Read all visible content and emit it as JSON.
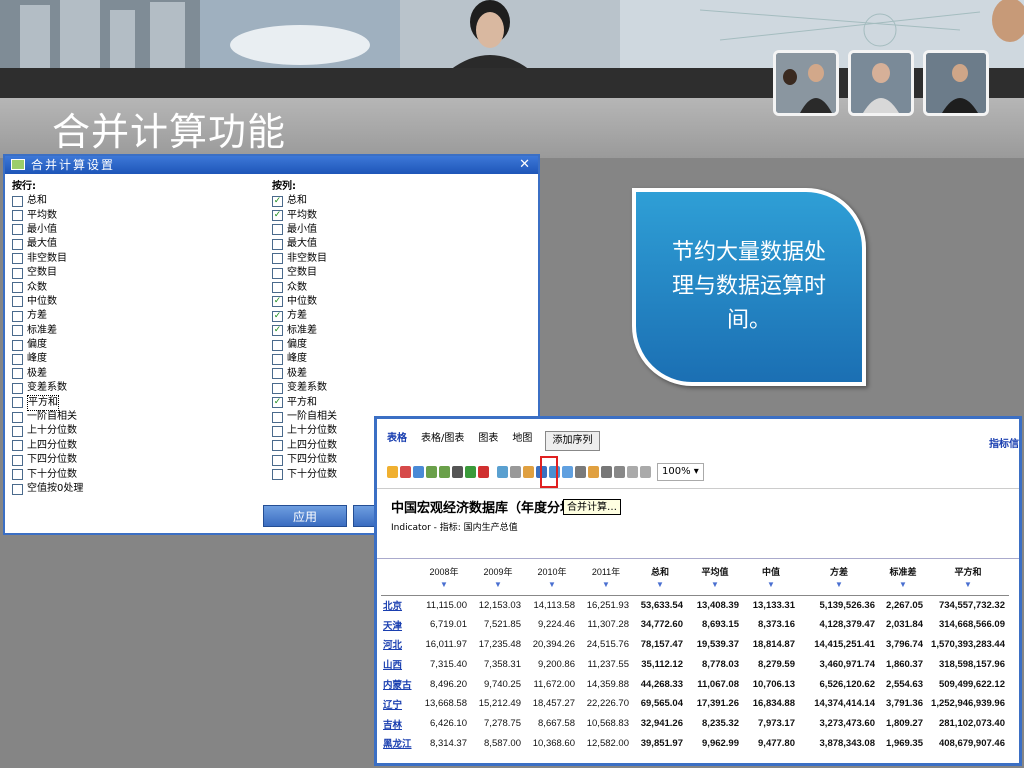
{
  "title": "合并计算功能",
  "dialog": {
    "title": "合并计算设置",
    "close": "✕",
    "row_header": "按行:",
    "col_header": "按列:",
    "row_options": [
      {
        "label": "总和",
        "checked": false
      },
      {
        "label": "平均数",
        "checked": false
      },
      {
        "label": "最小值",
        "checked": false
      },
      {
        "label": "最大值",
        "checked": false
      },
      {
        "label": "非空数目",
        "checked": false
      },
      {
        "label": "空数目",
        "checked": false
      },
      {
        "label": "众数",
        "checked": false
      },
      {
        "label": "中位数",
        "checked": false
      },
      {
        "label": "方差",
        "checked": false
      },
      {
        "label": "标准差",
        "checked": false
      },
      {
        "label": "偏度",
        "checked": false
      },
      {
        "label": "峰度",
        "checked": false
      },
      {
        "label": "极差",
        "checked": false
      },
      {
        "label": "变差系数",
        "checked": false
      },
      {
        "label": "平方和",
        "checked": false
      },
      {
        "label": "一阶自相关",
        "checked": false
      },
      {
        "label": "上十分位数",
        "checked": false
      },
      {
        "label": "上四分位数",
        "checked": false
      },
      {
        "label": "下四分位数",
        "checked": false
      },
      {
        "label": "下十分位数",
        "checked": false
      },
      {
        "label": "空值按0处理",
        "checked": false
      }
    ],
    "col_options": [
      {
        "label": "总和",
        "checked": true
      },
      {
        "label": "平均数",
        "checked": true
      },
      {
        "label": "最小值",
        "checked": false
      },
      {
        "label": "最大值",
        "checked": false
      },
      {
        "label": "非空数目",
        "checked": false
      },
      {
        "label": "空数目",
        "checked": false
      },
      {
        "label": "众数",
        "checked": false
      },
      {
        "label": "中位数",
        "checked": true
      },
      {
        "label": "方差",
        "checked": true
      },
      {
        "label": "标准差",
        "checked": true
      },
      {
        "label": "偏度",
        "checked": false
      },
      {
        "label": "峰度",
        "checked": false
      },
      {
        "label": "极差",
        "checked": false
      },
      {
        "label": "变差系数",
        "checked": false
      },
      {
        "label": "平方和",
        "checked": true
      },
      {
        "label": "一阶自相关",
        "checked": false
      },
      {
        "label": "上十分位数",
        "checked": false
      },
      {
        "label": "上四分位数",
        "checked": false
      },
      {
        "label": "下四分位数",
        "checked": false
      },
      {
        "label": "下十分位数",
        "checked": false
      }
    ],
    "apply_label": "应用"
  },
  "callout": {
    "text": "节约大量数据处理与数据运算时间。"
  },
  "window": {
    "tabs": [
      "表格",
      "表格/图表",
      "图表",
      "地图"
    ],
    "add_series": "添加序列",
    "right_link": "指标信",
    "zoom": "100%",
    "db_title": "中国宏观经济数据库（年度分地区",
    "tooltip": "合并计算…",
    "indicator": "Indicator - 指标: 国内生产总值",
    "columns": [
      "2008年",
      "2009年",
      "2010年",
      "2011年",
      "总和",
      "平均值",
      "中值",
      "方差",
      "标准差",
      "平方和"
    ],
    "rows": [
      [
        "北京",
        "11,115.00",
        "12,153.03",
        "14,113.58",
        "16,251.93",
        "53,633.54",
        "13,408.39",
        "13,133.31",
        "5,139,526.36",
        "2,267.05",
        "734,557,732.32"
      ],
      [
        "天津",
        "6,719.01",
        "7,521.85",
        "9,224.46",
        "11,307.28",
        "34,772.60",
        "8,693.15",
        "8,373.16",
        "4,128,379.47",
        "2,031.84",
        "314,668,566.09"
      ],
      [
        "河北",
        "16,011.97",
        "17,235.48",
        "20,394.26",
        "24,515.76",
        "78,157.47",
        "19,539.37",
        "18,814.87",
        "14,415,251.41",
        "3,796.74",
        "1,570,393,283.44"
      ],
      [
        "山西",
        "7,315.40",
        "7,358.31",
        "9,200.86",
        "11,237.55",
        "35,112.12",
        "8,778.03",
        "8,279.59",
        "3,460,971.74",
        "1,860.37",
        "318,598,157.96"
      ],
      [
        "内蒙古",
        "8,496.20",
        "9,740.25",
        "11,672.00",
        "14,359.88",
        "44,268.33",
        "11,067.08",
        "10,706.13",
        "6,526,120.62",
        "2,554.63",
        "509,499,622.12"
      ],
      [
        "辽宁",
        "13,668.58",
        "15,212.49",
        "18,457.27",
        "22,226.70",
        "69,565.04",
        "17,391.26",
        "16,834.88",
        "14,374,414.14",
        "3,791.36",
        "1,252,946,939.96"
      ],
      [
        "吉林",
        "6,426.10",
        "7,278.75",
        "8,667.58",
        "10,568.83",
        "32,941.26",
        "8,235.32",
        "7,973.17",
        "3,273,473.60",
        "1,809.27",
        "281,102,073.40"
      ],
      [
        "黑龙江",
        "8,314.37",
        "8,587.00",
        "10,368.60",
        "12,582.00",
        "39,851.97",
        "9,962.99",
        "9,477.80",
        "3,878,343.08",
        "1,969.35",
        "408,679,907.46"
      ]
    ]
  }
}
